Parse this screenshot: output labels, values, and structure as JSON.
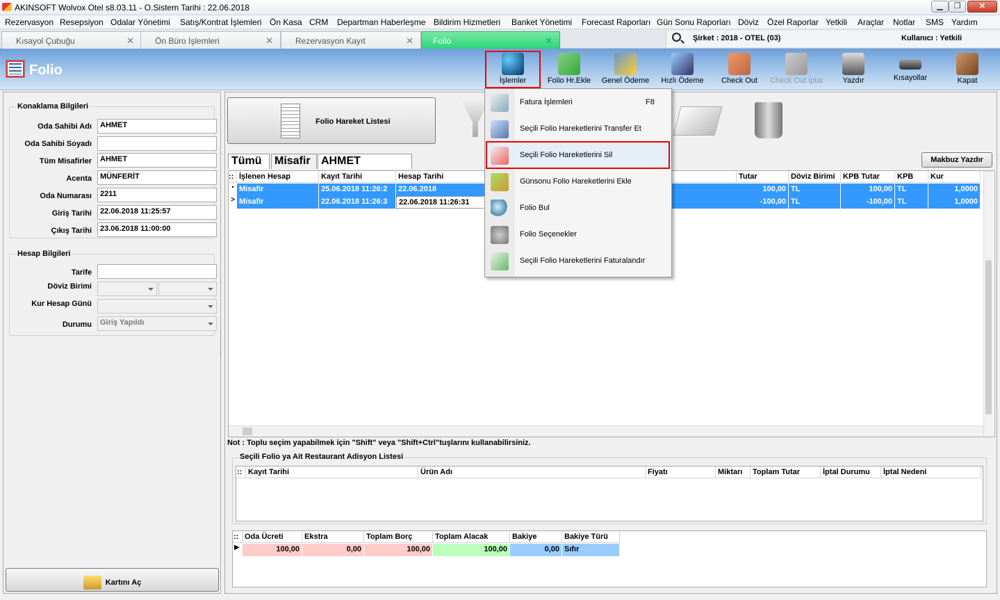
{
  "window": {
    "title": "AKINSOFT Wolvox Otel s8.03.11 - O.Sistem Tarihi : 22.06.2018"
  },
  "menu": [
    "Rezervasyon",
    "Resepsiyon",
    "Odalar Yönetimi",
    "Satış/Kontrat İşlemleri",
    "Ön Kasa",
    "CRM",
    "Departman Haberleşme",
    "Bildirim Hizmetleri",
    "Banket Yönetimi",
    "Forecast Raporları",
    "Gün Sonu Raporları",
    "Döviz",
    "Özel Raporlar",
    "Yetkili",
    "Araçlar",
    "Notlar",
    "SMS",
    "Yardım"
  ],
  "tabs": [
    "Kısayol Çubuğu",
    "Ön Büro İşlemleri",
    "Rezervasyon Kayıt",
    "Folio"
  ],
  "company": {
    "sirket": "Şirket : 2018 - OTEL (03)",
    "kullanici": "Kullanıcı : Yetkili"
  },
  "header": {
    "title": "Folio"
  },
  "toolbar": [
    "İşlemler",
    "Folio Hr.Ekle",
    "Genel Ödeme",
    "Hızlı Ödeme",
    "Check Out",
    "Check Out İptal",
    "Yazdır",
    "Kısayollar",
    "Kapat"
  ],
  "konaklama": {
    "title": "Konaklama Bilgileri",
    "labels": [
      "Oda Sahibi Adı",
      "Oda Sahibi Soyadı",
      "Tüm Misafirler",
      "Acenta",
      "Oda Numarası",
      "Giriş Tarihi",
      "Çıkış Tarihi"
    ],
    "values": [
      "AHMET",
      "",
      "AHMET",
      "MÜNFERİT",
      "2211",
      "22.06.2018 11:25:57",
      "23.06.2018 11:00:00"
    ]
  },
  "hesap": {
    "title": "Hesap Bilgileri",
    "labels": [
      "Tarife",
      "Döviz Birimi",
      "Kur Hesap Günü",
      "Durumu"
    ],
    "durum": "Giriş Yapıldı"
  },
  "kartini_ac": "Kartını Aç",
  "folio_hareket_listesi": "Folio Hareket Listesi",
  "filter_tabs": [
    "Tümü",
    "Misafir",
    "AHMET"
  ],
  "makbuz": "Makbuz Yazdır",
  "grid": {
    "headers": [
      "İşlenen Hesap",
      "Kayıt Tarihi",
      "Hesap Tarihi",
      "Tutar",
      "Döviz Birimi",
      "KPB Tutar",
      "KPB",
      "Kur"
    ],
    "rows": [
      [
        "Misafir",
        "25.06.2018 11:26:2",
        "22.06.2018",
        "100,00",
        "TL",
        "100,00",
        "TL",
        "1,0000"
      ],
      [
        "Misafir",
        "22.06.2018 11:26:3",
        "22.06.2018 11:26:31",
        "-100,00",
        "TL",
        "-100,00",
        "TL",
        "1,0000"
      ]
    ]
  },
  "note": "Not : Toplu seçim yapabilmek için \"Shift\" veya \"Shift+Ctrl\"tuşlarını kullanabilirsiniz.",
  "adisyon": {
    "title": "Seçili Folio ya Ait Restaurant Adisyon Listesi",
    "headers": [
      "Kayıt Tarihi",
      "Ürün Adı",
      "Fiyatı",
      "Miktarı",
      "Toplam Tutar",
      "İptal Durumu",
      "İptal Nedeni"
    ]
  },
  "summary": {
    "headers": [
      "Oda Ücreti",
      "Ekstra",
      "Toplam Borç",
      "Toplam Alacak",
      "Bakiye",
      "Bakiye Türü"
    ],
    "values": [
      "100,00",
      "0,00",
      "100,00",
      "100,00",
      "0,00",
      "Sıfır"
    ]
  },
  "dropdown": {
    "items": [
      "Fatura İşlemleri",
      "Seçili Folio Hareketlerini Transfer Et",
      "Seçili Folio Hareketlerini Sil",
      "Günsonu Folio Hareketlerini Ekle",
      "Folio Bul",
      "Folio Seçenekler",
      "Seçili Folio Hareketlerini Faturalandır"
    ],
    "shortcut": "F8"
  }
}
